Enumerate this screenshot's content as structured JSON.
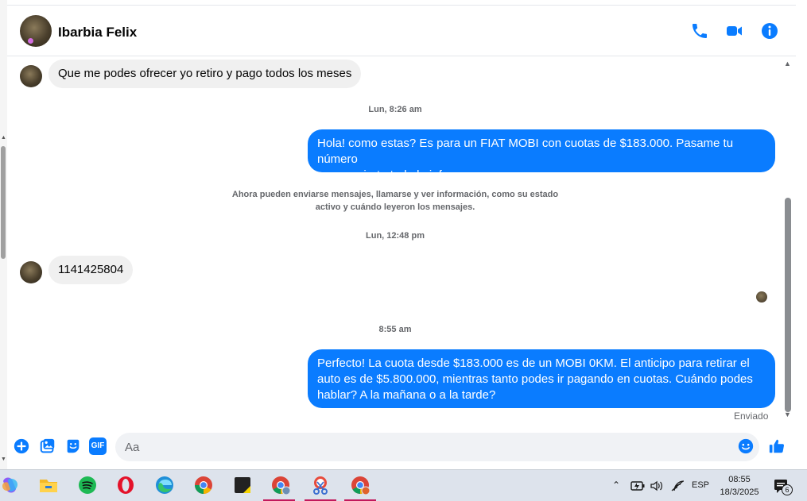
{
  "header": {
    "contact_name": "Ibarbia Felix"
  },
  "messages": {
    "m1_text": "Que me podes ofrecer yo retiro y pago todos los meses",
    "ts1": "Lun, 8:26 am",
    "m2_line1": "Hola! como estas? Es para un FIAT MOBI con cuotas de $183.000. Pasame tu número",
    "m2_line2": "para enviarte toda la info",
    "sys_line1": "Ahora pueden enviarse mensajes, llamarse y ver información, como su estado",
    "sys_line2": "activo y cuándo leyeron los mensajes.",
    "ts2": "Lun, 12:48 pm",
    "m3_text": "1141425804",
    "ts3": "8:55 am",
    "m4_line1": "Perfecto! La cuota desde $183.000 es de un MOBI 0KM. El anticipo para retirar el",
    "m4_line2": "auto es de $5.800.000, mientras tanto podes ir pagando en cuotas. Cuándo podes",
    "m4_line3": "hablar? A la mañana o a la tarde?",
    "sent_status": "Enviado"
  },
  "composer": {
    "placeholder": "Aa",
    "gif_label": "GIF"
  },
  "taskbar": {
    "language": "ESP",
    "time": "08:55",
    "date": "18/3/2025",
    "notification_count": "6"
  },
  "colors": {
    "accent": "#0a7cff",
    "incoming_bubble": "#f0f0f0",
    "taskbar": "#dde3ec"
  }
}
